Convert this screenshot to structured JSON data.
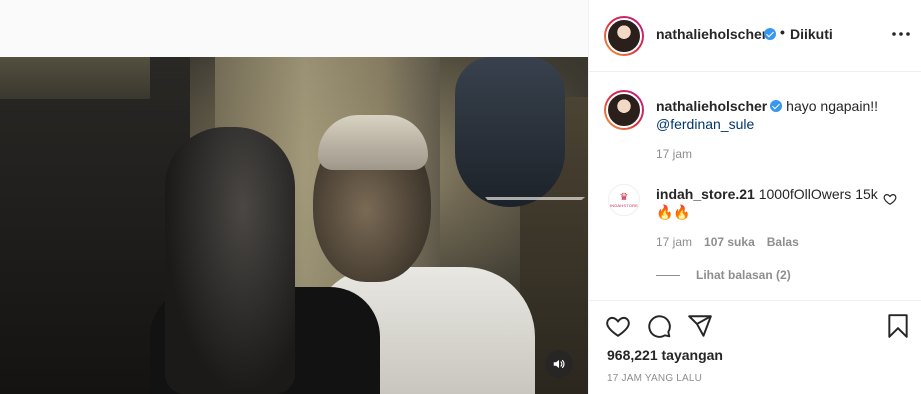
{
  "post": {
    "username": "nathalieholscher",
    "follow_status": "Diikuti",
    "header_separator": "•",
    "caption": "hayo ngapain!!",
    "caption_mention": "@ferdinan_sule",
    "caption_time": "17 jam"
  },
  "comment": {
    "username": "indah_store.21",
    "text": "1000fOllOwers 15k 🔥🔥",
    "time": "17 jam",
    "likes": "107 suka",
    "reply_label": "Balas",
    "view_replies": "Lihat balasan (2)",
    "avatar_logo_text": "INDAHSTORE"
  },
  "stats": {
    "views": "968,221 tayangan",
    "date": "17 JAM YANG LALU"
  },
  "colors": {
    "verified": "#3897f0",
    "mention": "#00376b",
    "muted": "#8e8e8e"
  },
  "icons": [
    "volume-icon",
    "verified-icon",
    "more-icon",
    "heart-icon",
    "comment-icon",
    "share-icon",
    "bookmark-icon"
  ]
}
